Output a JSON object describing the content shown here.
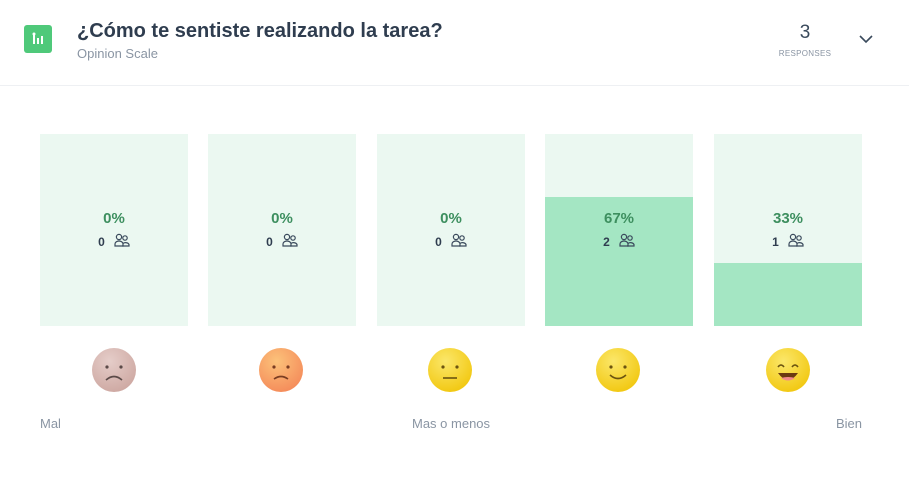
{
  "question": {
    "title": "¿Cómo te sentiste realizando la tarea?",
    "type": "Opinion Scale",
    "icon": "opinion-scale-icon"
  },
  "responses": {
    "count": "3",
    "label": "RESPONSES"
  },
  "colors": {
    "accent": "#4fc97a",
    "bar_bg": "#ebf8f1",
    "bar_fill": "#a4e6c3",
    "percent_text": "#3d8f5f"
  },
  "options": [
    {
      "percent": "0%",
      "count": "0",
      "share": 0,
      "face": "sad-face-icon"
    },
    {
      "percent": "0%",
      "count": "0",
      "share": 0,
      "face": "frown-face-icon"
    },
    {
      "percent": "0%",
      "count": "0",
      "share": 0,
      "face": "neutral-face-icon"
    },
    {
      "percent": "67%",
      "count": "2",
      "share": 0.67,
      "face": "smile-face-icon"
    },
    {
      "percent": "33%",
      "count": "1",
      "share": 0.33,
      "face": "grin-face-icon"
    }
  ],
  "scale_labels": {
    "low": "Mal",
    "mid": "Mas o menos",
    "high": "Bien"
  }
}
